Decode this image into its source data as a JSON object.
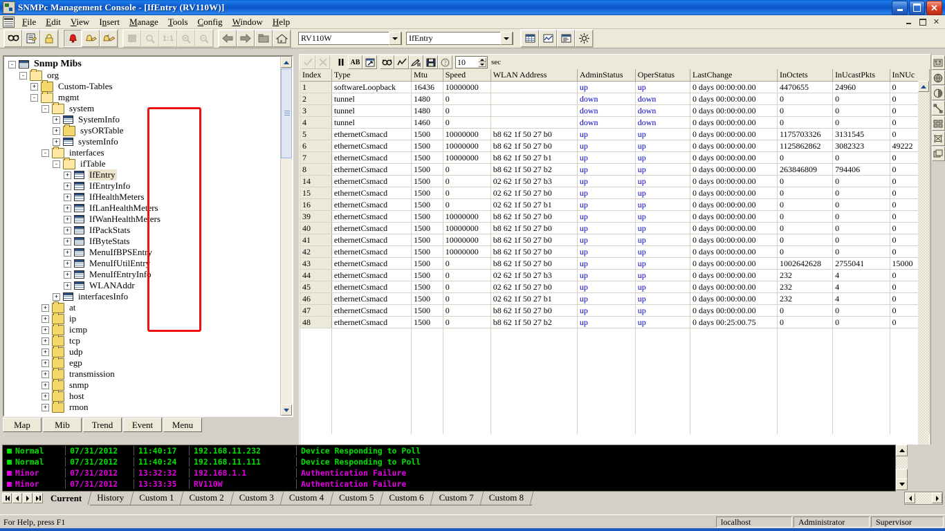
{
  "window": {
    "title": "SNMPc Management Console - [IfEntry (RV110W)]",
    "app_icon": "snmpc-icon",
    "buttons": {
      "minimize": "minimize",
      "restore": "restore",
      "close": "close"
    },
    "mdi_buttons": {
      "minimize": "minimize",
      "restore": "restore",
      "close": "close"
    }
  },
  "menu": {
    "items": [
      "File",
      "Edit",
      "View",
      "Insert",
      "Manage",
      "Tools",
      "Config",
      "Window",
      "Help"
    ]
  },
  "toolbar": {
    "buttons": [
      {
        "name": "find-icon",
        "group": 1,
        "state": "raised"
      },
      {
        "name": "properties-icon",
        "group": 1,
        "state": "raised"
      },
      {
        "name": "lock-icon",
        "group": 1,
        "state": "raised"
      },
      {
        "name": "alarm-bell-icon",
        "group": 2,
        "state": "pressed"
      },
      {
        "name": "bell-ack-icon",
        "group": 2,
        "state": "raised"
      },
      {
        "name": "bell-clear-icon",
        "group": 2,
        "state": "raised"
      },
      {
        "name": "stop-icon",
        "group": 3,
        "state": "disabled"
      },
      {
        "name": "zoom-icon",
        "group": 3,
        "state": "disabled"
      },
      {
        "name": "zoom-1-1-icon",
        "group": 3,
        "state": "disabled",
        "label": "1:1"
      },
      {
        "name": "zoom-in-icon",
        "group": 3,
        "state": "disabled"
      },
      {
        "name": "zoom-out-icon",
        "group": 3,
        "state": "disabled"
      },
      {
        "name": "back-arrow-icon",
        "group": 4,
        "state": "raised"
      },
      {
        "name": "forward-arrow-icon",
        "group": 4,
        "state": "raised"
      },
      {
        "name": "up-folder-icon",
        "group": 4,
        "state": "raised"
      },
      {
        "name": "home-icon",
        "group": 4,
        "state": "raised"
      }
    ],
    "device_combo": {
      "value": "RV110W"
    },
    "table_combo": {
      "value": "IfEntry"
    },
    "right_buttons": [
      {
        "name": "table-view-icon"
      },
      {
        "name": "graph-view-icon"
      },
      {
        "name": "report-view-icon"
      },
      {
        "name": "settings-sun-icon"
      }
    ]
  },
  "tree": {
    "nodes": [
      {
        "label": "Snmp Mibs",
        "depth": 0,
        "expander": "-",
        "icon": "mib-table-icon",
        "bold": true,
        "selected": false
      },
      {
        "label": "org",
        "depth": 1,
        "expander": "-",
        "icon": "folder-open-icon",
        "bold": false,
        "selected": false
      },
      {
        "label": "Custom-Tables",
        "depth": 2,
        "expander": "+",
        "icon": "folder-icon",
        "bold": false,
        "selected": false
      },
      {
        "label": "mgmt",
        "depth": 2,
        "expander": "-",
        "icon": "folder-open-icon",
        "bold": false,
        "selected": false
      },
      {
        "label": "system",
        "depth": 3,
        "expander": "-",
        "icon": "folder-open-icon",
        "bold": false,
        "selected": false
      },
      {
        "label": "SystemInfo",
        "depth": 4,
        "expander": "+",
        "icon": "mib-table-icon",
        "bold": false,
        "selected": false
      },
      {
        "label": "sysORTable",
        "depth": 4,
        "expander": "+",
        "icon": "folder-icon",
        "bold": false,
        "selected": false
      },
      {
        "label": "systemInfo",
        "depth": 4,
        "expander": "+",
        "icon": "mib-table-icon",
        "bold": false,
        "selected": false
      },
      {
        "label": "interfaces",
        "depth": 3,
        "expander": "-",
        "icon": "folder-open-icon",
        "bold": false,
        "selected": false
      },
      {
        "label": "ifTable",
        "depth": 4,
        "expander": "-",
        "icon": "folder-open-icon",
        "bold": false,
        "selected": false
      },
      {
        "label": "IfEntry",
        "depth": 5,
        "expander": "+",
        "icon": "mib-table-icon",
        "bold": false,
        "selected": true
      },
      {
        "label": "IfEntryInfo",
        "depth": 5,
        "expander": "+",
        "icon": "mib-table-icon",
        "bold": false,
        "selected": false
      },
      {
        "label": "IfHealthMeters",
        "depth": 5,
        "expander": "+",
        "icon": "mib-table-icon",
        "bold": false,
        "selected": false
      },
      {
        "label": "IfLanHealthMeters",
        "depth": 5,
        "expander": "+",
        "icon": "mib-table-icon",
        "bold": false,
        "selected": false
      },
      {
        "label": "IfWanHealthMeters",
        "depth": 5,
        "expander": "+",
        "icon": "mib-table-icon",
        "bold": false,
        "selected": false
      },
      {
        "label": "IfPackStats",
        "depth": 5,
        "expander": "+",
        "icon": "mib-table-icon",
        "bold": false,
        "selected": false
      },
      {
        "label": "IfByteStats",
        "depth": 5,
        "expander": "+",
        "icon": "mib-table-icon",
        "bold": false,
        "selected": false
      },
      {
        "label": "MenuIfBPSEntry",
        "depth": 5,
        "expander": "+",
        "icon": "mib-table-icon",
        "bold": false,
        "selected": false
      },
      {
        "label": "MenuIfUtilEntry",
        "depth": 5,
        "expander": "+",
        "icon": "mib-table-icon",
        "bold": false,
        "selected": false
      },
      {
        "label": "MenuIfEntryInfo",
        "depth": 5,
        "expander": "+",
        "icon": "mib-table-icon",
        "bold": false,
        "selected": false
      },
      {
        "label": "WLANAddr",
        "depth": 5,
        "expander": "+",
        "icon": "mib-table-icon",
        "bold": false,
        "selected": false
      },
      {
        "label": "interfacesInfo",
        "depth": 4,
        "expander": "+",
        "icon": "mib-table-icon",
        "bold": false,
        "selected": false
      },
      {
        "label": "at",
        "depth": 3,
        "expander": "+",
        "icon": "folder-icon",
        "bold": false,
        "selected": false
      },
      {
        "label": "ip",
        "depth": 3,
        "expander": "+",
        "icon": "folder-icon",
        "bold": false,
        "selected": false
      },
      {
        "label": "icmp",
        "depth": 3,
        "expander": "+",
        "icon": "folder-icon",
        "bold": false,
        "selected": false
      },
      {
        "label": "tcp",
        "depth": 3,
        "expander": "+",
        "icon": "folder-icon",
        "bold": false,
        "selected": false
      },
      {
        "label": "udp",
        "depth": 3,
        "expander": "+",
        "icon": "folder-icon",
        "bold": false,
        "selected": false
      },
      {
        "label": "egp",
        "depth": 3,
        "expander": "+",
        "icon": "folder-icon",
        "bold": false,
        "selected": false
      },
      {
        "label": "transmission",
        "depth": 3,
        "expander": "+",
        "icon": "folder-icon",
        "bold": false,
        "selected": false
      },
      {
        "label": "snmp",
        "depth": 3,
        "expander": "+",
        "icon": "folder-icon",
        "bold": false,
        "selected": false
      },
      {
        "label": "host",
        "depth": 3,
        "expander": "+",
        "icon": "folder-icon",
        "bold": false,
        "selected": false
      },
      {
        "label": "rmon",
        "depth": 3,
        "expander": "+",
        "icon": "folder-icon",
        "bold": false,
        "selected": false
      }
    ],
    "bottom_tabs": [
      "Map",
      "Mib",
      "Trend",
      "Event",
      "Menu"
    ]
  },
  "table_toolbar": {
    "buttons": [
      {
        "name": "apply-check-icon",
        "state": "disabled"
      },
      {
        "name": "cancel-x-icon",
        "state": "disabled"
      },
      {
        "name": "pause-icon",
        "state": "raised"
      },
      {
        "name": "text-ab-icon",
        "state": "pressed"
      },
      {
        "name": "export-icon",
        "state": "raised"
      },
      {
        "name": "find-icon",
        "state": "raised"
      },
      {
        "name": "graph-icon",
        "state": "raised"
      },
      {
        "name": "edit-pencil-icon",
        "state": "raised"
      },
      {
        "name": "save-disk-icon",
        "state": "raised"
      },
      {
        "name": "help-question-icon",
        "state": "raised"
      }
    ],
    "poll_interval": "10",
    "poll_unit": "sec"
  },
  "grid": {
    "columns": [
      "Index",
      "Type",
      "Mtu",
      "Speed",
      "WLAN Address",
      "AdminStatus",
      "OperStatus",
      "LastChange",
      "InOctets",
      "InUcastPkts",
      "InNUc"
    ],
    "rows": [
      [
        "1",
        "softwareLoopback",
        "16436",
        "10000000",
        "",
        "up",
        "up",
        "0 days 00:00:00.00",
        "4470655",
        "24960",
        "0"
      ],
      [
        "2",
        "tunnel",
        "1480",
        "0",
        "",
        "down",
        "down",
        "0 days 00:00:00.00",
        "0",
        "0",
        "0"
      ],
      [
        "3",
        "tunnel",
        "1480",
        "0",
        "",
        "down",
        "down",
        "0 days 00:00:00.00",
        "0",
        "0",
        "0"
      ],
      [
        "4",
        "tunnel",
        "1460",
        "0",
        "",
        "down",
        "down",
        "0 days 00:00:00.00",
        "0",
        "0",
        "0"
      ],
      [
        "5",
        "ethernetCsmacd",
        "1500",
        "10000000",
        "b8 62 1f 50 27 b0",
        "up",
        "up",
        "0 days 00:00:00.00",
        "1175703326",
        "3131545",
        "0"
      ],
      [
        "6",
        "ethernetCsmacd",
        "1500",
        "10000000",
        "b8 62 1f 50 27 b0",
        "up",
        "up",
        "0 days 00:00:00.00",
        "1125862862",
        "3082323",
        "49222"
      ],
      [
        "7",
        "ethernetCsmacd",
        "1500",
        "10000000",
        "b8 62 1f 50 27 b1",
        "up",
        "up",
        "0 days 00:00:00.00",
        "0",
        "0",
        "0"
      ],
      [
        "8",
        "ethernetCsmacd",
        "1500",
        "0",
        "b8 62 1f 50 27 b2",
        "up",
        "up",
        "0 days 00:00:00.00",
        "263846809",
        "794406",
        "0"
      ],
      [
        "14",
        "ethernetCsmacd",
        "1500",
        "0",
        "02 62 1f 50 27 b3",
        "up",
        "up",
        "0 days 00:00:00.00",
        "0",
        "0",
        "0"
      ],
      [
        "15",
        "ethernetCsmacd",
        "1500",
        "0",
        "02 62 1f 50 27 b0",
        "up",
        "up",
        "0 days 00:00:00.00",
        "0",
        "0",
        "0"
      ],
      [
        "16",
        "ethernetCsmacd",
        "1500",
        "0",
        "02 62 1f 50 27 b1",
        "up",
        "up",
        "0 days 00:00:00.00",
        "0",
        "0",
        "0"
      ],
      [
        "39",
        "ethernetCsmacd",
        "1500",
        "10000000",
        "b8 62 1f 50 27 b0",
        "up",
        "up",
        "0 days 00:00:00.00",
        "0",
        "0",
        "0"
      ],
      [
        "40",
        "ethernetCsmacd",
        "1500",
        "10000000",
        "b8 62 1f 50 27 b0",
        "up",
        "up",
        "0 days 00:00:00.00",
        "0",
        "0",
        "0"
      ],
      [
        "41",
        "ethernetCsmacd",
        "1500",
        "10000000",
        "b8 62 1f 50 27 b0",
        "up",
        "up",
        "0 days 00:00:00.00",
        "0",
        "0",
        "0"
      ],
      [
        "42",
        "ethernetCsmacd",
        "1500",
        "10000000",
        "b8 62 1f 50 27 b0",
        "up",
        "up",
        "0 days 00:00:00.00",
        "0",
        "0",
        "0"
      ],
      [
        "43",
        "ethernetCsmacd",
        "1500",
        "0",
        "b8 62 1f 50 27 b0",
        "up",
        "up",
        "0 days 00:00:00.00",
        "1002642628",
        "2755041",
        "15000"
      ],
      [
        "44",
        "ethernetCsmacd",
        "1500",
        "0",
        "02 62 1f 50 27 b3",
        "up",
        "up",
        "0 days 00:00:00.00",
        "232",
        "4",
        "0"
      ],
      [
        "45",
        "ethernetCsmacd",
        "1500",
        "0",
        "02 62 1f 50 27 b0",
        "up",
        "up",
        "0 days 00:00:00.00",
        "232",
        "4",
        "0"
      ],
      [
        "46",
        "ethernetCsmacd",
        "1500",
        "0",
        "02 62 1f 50 27 b1",
        "up",
        "up",
        "0 days 00:00:00.00",
        "232",
        "4",
        "0"
      ],
      [
        "47",
        "ethernetCsmacd",
        "1500",
        "0",
        "b8 62 1f 50 27 b0",
        "up",
        "up",
        "0 days 00:00:00.00",
        "0",
        "0",
        "0"
      ],
      [
        "48",
        "ethernetCsmacd",
        "1500",
        "0",
        "b8 62 1f 50 27 b2",
        "up",
        "up",
        "0 days 00:25:00.75",
        "0",
        "0",
        "0"
      ]
    ]
  },
  "annotation": {
    "color": "#ee1111",
    "target_column": "Speed"
  },
  "side_toolbar": {
    "buttons": [
      {
        "name": "map-view-icon"
      },
      {
        "name": "globe-icon"
      },
      {
        "name": "globe-half-icon"
      },
      {
        "name": "link-line-icon"
      },
      {
        "name": "subnet-icon"
      },
      {
        "name": "mesh-icon"
      },
      {
        "name": "submap-icon"
      }
    ]
  },
  "event_log": {
    "entries": [
      {
        "severity": "Normal",
        "date": "07/31/2012",
        "time": "11:40:17",
        "source": "192.168.11.232",
        "message": "Device Responding to Poll",
        "color": "#00e000"
      },
      {
        "severity": "Normal",
        "date": "07/31/2012",
        "time": "11:40:24",
        "source": "192.168.11.111",
        "message": "Device Responding to Poll",
        "color": "#00e000"
      },
      {
        "severity": "Minor",
        "date": "07/31/2012",
        "time": "13:32:32",
        "source": "192.168.1.1",
        "message": "Authentication Failure",
        "color": "#e000e0"
      },
      {
        "severity": "Minor",
        "date": "07/31/2012",
        "time": "13:33:35",
        "source": "RV110W",
        "message": "Authentication Failure",
        "color": "#e000e0"
      }
    ],
    "tabs": [
      "Current",
      "History",
      "Custom 1",
      "Custom 2",
      "Custom 3",
      "Custom 4",
      "Custom 5",
      "Custom 6",
      "Custom 7",
      "Custom 8"
    ],
    "active_tab": "Current"
  },
  "status_bar": {
    "help_text": "For Help, press F1",
    "cells": [
      "localhost",
      "Administrator",
      "Supervisor"
    ]
  }
}
